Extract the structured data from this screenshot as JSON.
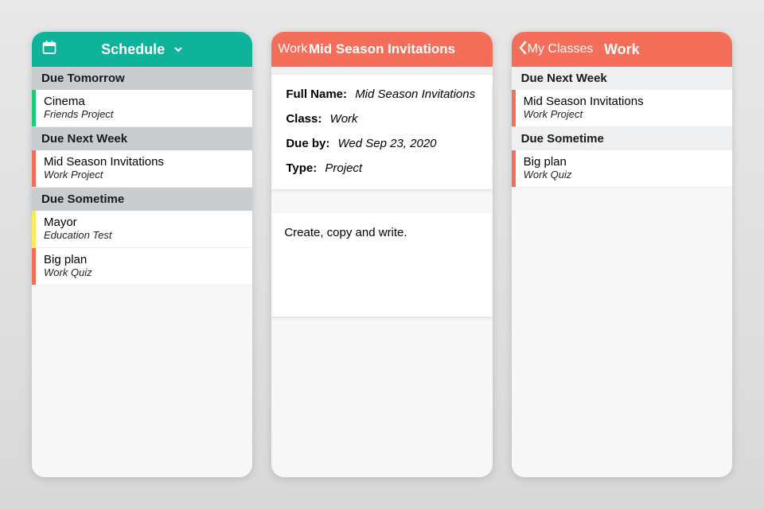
{
  "colors": {
    "teal": "#0FB39A",
    "coral": "#F56E5A",
    "green": "#1EC97B",
    "yellow": "#F7E958"
  },
  "screen1": {
    "title": "Schedule",
    "sections": [
      {
        "header": "Due Tomorrow",
        "items": [
          {
            "title": "Cinema",
            "sub": "Friends Project",
            "stripe": "#1EC97B"
          }
        ]
      },
      {
        "header": "Due Next Week",
        "items": [
          {
            "title": "Mid Season Invitations",
            "sub": "Work Project",
            "stripe": "#F56E5A"
          }
        ]
      },
      {
        "header": "Due Sometime",
        "items": [
          {
            "title": "Mayor",
            "sub": "Education Test",
            "stripe": "#F7E958"
          },
          {
            "title": "Big plan",
            "sub": "Work Quiz",
            "stripe": "#F56E5A"
          }
        ]
      }
    ]
  },
  "screen2": {
    "back": "Work",
    "title": "Mid Season Invitations",
    "details": {
      "fullname_label": "Full Name:",
      "fullname_value": "Mid Season Invitations",
      "class_label": "Class:",
      "class_value": "Work",
      "dueby_label": "Due by:",
      "dueby_value": "Wed Sep 23, 2020",
      "type_label": "Type:",
      "type_value": "Project"
    },
    "note": "Create, copy and write."
  },
  "screen3": {
    "back": "My Classes",
    "title": "Work",
    "sections": [
      {
        "header": "Due Next Week",
        "items": [
          {
            "title": "Mid Season Invitations",
            "sub": "Work Project",
            "stripe": "#F56E5A"
          }
        ]
      },
      {
        "header": "Due Sometime",
        "items": [
          {
            "title": "Big plan",
            "sub": "Work Quiz",
            "stripe": "#F56E5A"
          }
        ]
      }
    ]
  }
}
